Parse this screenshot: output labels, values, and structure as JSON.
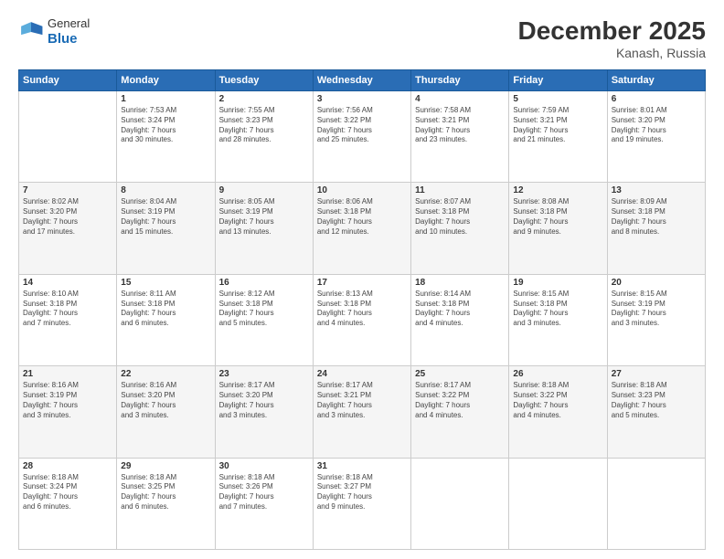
{
  "header": {
    "logo_general": "General",
    "logo_blue": "Blue",
    "title": "December 2025",
    "subtitle": "Kanash, Russia"
  },
  "days_of_week": [
    "Sunday",
    "Monday",
    "Tuesday",
    "Wednesday",
    "Thursday",
    "Friday",
    "Saturday"
  ],
  "weeks": [
    [
      {
        "day": "",
        "info": ""
      },
      {
        "day": "1",
        "info": "Sunrise: 7:53 AM\nSunset: 3:24 PM\nDaylight: 7 hours\nand 30 minutes."
      },
      {
        "day": "2",
        "info": "Sunrise: 7:55 AM\nSunset: 3:23 PM\nDaylight: 7 hours\nand 28 minutes."
      },
      {
        "day": "3",
        "info": "Sunrise: 7:56 AM\nSunset: 3:22 PM\nDaylight: 7 hours\nand 25 minutes."
      },
      {
        "day": "4",
        "info": "Sunrise: 7:58 AM\nSunset: 3:21 PM\nDaylight: 7 hours\nand 23 minutes."
      },
      {
        "day": "5",
        "info": "Sunrise: 7:59 AM\nSunset: 3:21 PM\nDaylight: 7 hours\nand 21 minutes."
      },
      {
        "day": "6",
        "info": "Sunrise: 8:01 AM\nSunset: 3:20 PM\nDaylight: 7 hours\nand 19 minutes."
      }
    ],
    [
      {
        "day": "7",
        "info": "Sunrise: 8:02 AM\nSunset: 3:20 PM\nDaylight: 7 hours\nand 17 minutes."
      },
      {
        "day": "8",
        "info": "Sunrise: 8:04 AM\nSunset: 3:19 PM\nDaylight: 7 hours\nand 15 minutes."
      },
      {
        "day": "9",
        "info": "Sunrise: 8:05 AM\nSunset: 3:19 PM\nDaylight: 7 hours\nand 13 minutes."
      },
      {
        "day": "10",
        "info": "Sunrise: 8:06 AM\nSunset: 3:18 PM\nDaylight: 7 hours\nand 12 minutes."
      },
      {
        "day": "11",
        "info": "Sunrise: 8:07 AM\nSunset: 3:18 PM\nDaylight: 7 hours\nand 10 minutes."
      },
      {
        "day": "12",
        "info": "Sunrise: 8:08 AM\nSunset: 3:18 PM\nDaylight: 7 hours\nand 9 minutes."
      },
      {
        "day": "13",
        "info": "Sunrise: 8:09 AM\nSunset: 3:18 PM\nDaylight: 7 hours\nand 8 minutes."
      }
    ],
    [
      {
        "day": "14",
        "info": "Sunrise: 8:10 AM\nSunset: 3:18 PM\nDaylight: 7 hours\nand 7 minutes."
      },
      {
        "day": "15",
        "info": "Sunrise: 8:11 AM\nSunset: 3:18 PM\nDaylight: 7 hours\nand 6 minutes."
      },
      {
        "day": "16",
        "info": "Sunrise: 8:12 AM\nSunset: 3:18 PM\nDaylight: 7 hours\nand 5 minutes."
      },
      {
        "day": "17",
        "info": "Sunrise: 8:13 AM\nSunset: 3:18 PM\nDaylight: 7 hours\nand 4 minutes."
      },
      {
        "day": "18",
        "info": "Sunrise: 8:14 AM\nSunset: 3:18 PM\nDaylight: 7 hours\nand 4 minutes."
      },
      {
        "day": "19",
        "info": "Sunrise: 8:15 AM\nSunset: 3:18 PM\nDaylight: 7 hours\nand 3 minutes."
      },
      {
        "day": "20",
        "info": "Sunrise: 8:15 AM\nSunset: 3:19 PM\nDaylight: 7 hours\nand 3 minutes."
      }
    ],
    [
      {
        "day": "21",
        "info": "Sunrise: 8:16 AM\nSunset: 3:19 PM\nDaylight: 7 hours\nand 3 minutes."
      },
      {
        "day": "22",
        "info": "Sunrise: 8:16 AM\nSunset: 3:20 PM\nDaylight: 7 hours\nand 3 minutes."
      },
      {
        "day": "23",
        "info": "Sunrise: 8:17 AM\nSunset: 3:20 PM\nDaylight: 7 hours\nand 3 minutes."
      },
      {
        "day": "24",
        "info": "Sunrise: 8:17 AM\nSunset: 3:21 PM\nDaylight: 7 hours\nand 3 minutes."
      },
      {
        "day": "25",
        "info": "Sunrise: 8:17 AM\nSunset: 3:22 PM\nDaylight: 7 hours\nand 4 minutes."
      },
      {
        "day": "26",
        "info": "Sunrise: 8:18 AM\nSunset: 3:22 PM\nDaylight: 7 hours\nand 4 minutes."
      },
      {
        "day": "27",
        "info": "Sunrise: 8:18 AM\nSunset: 3:23 PM\nDaylight: 7 hours\nand 5 minutes."
      }
    ],
    [
      {
        "day": "28",
        "info": "Sunrise: 8:18 AM\nSunset: 3:24 PM\nDaylight: 7 hours\nand 6 minutes."
      },
      {
        "day": "29",
        "info": "Sunrise: 8:18 AM\nSunset: 3:25 PM\nDaylight: 7 hours\nand 6 minutes."
      },
      {
        "day": "30",
        "info": "Sunrise: 8:18 AM\nSunset: 3:26 PM\nDaylight: 7 hours\nand 7 minutes."
      },
      {
        "day": "31",
        "info": "Sunrise: 8:18 AM\nSunset: 3:27 PM\nDaylight: 7 hours\nand 9 minutes."
      },
      {
        "day": "",
        "info": ""
      },
      {
        "day": "",
        "info": ""
      },
      {
        "day": "",
        "info": ""
      }
    ]
  ]
}
